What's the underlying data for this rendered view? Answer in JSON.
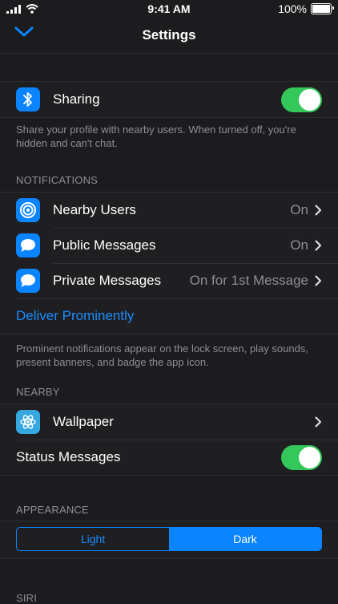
{
  "status_bar": {
    "time": "9:41 AM",
    "battery": "100%"
  },
  "nav": {
    "title": "Settings"
  },
  "sharing": {
    "label": "Sharing",
    "toggle": "on",
    "footer": "Share your profile with nearby users. When turned off, you're hidden and can't chat."
  },
  "notifications": {
    "header": "NOTIFICATIONS",
    "items": [
      {
        "label": "Nearby Users",
        "value": "On",
        "icon": "target-icon"
      },
      {
        "label": "Public Messages",
        "value": "On",
        "icon": "speech-bubble-icon"
      },
      {
        "label": "Private Messages",
        "value": "On for 1st Message",
        "icon": "speech-bubble-icon"
      }
    ],
    "deliver_label": "Deliver Prominently",
    "footer": "Prominent notifications appear on the lock screen, play sounds, present banners, and badge the app icon."
  },
  "nearby": {
    "header": "NEARBY",
    "wallpaper_label": "Wallpaper",
    "status_label": "Status Messages",
    "status_toggle": "on"
  },
  "appearance": {
    "header": "APPEARANCE",
    "options": [
      "Light",
      "Dark"
    ],
    "selected": "Dark"
  },
  "siri": {
    "header": "SIRI"
  },
  "colors": {
    "background": "#1c1c1e",
    "cell": "#1f1f21",
    "accent": "#0a84ff",
    "toggle_on": "#34c759",
    "secondary_text": "#8e8e93"
  }
}
